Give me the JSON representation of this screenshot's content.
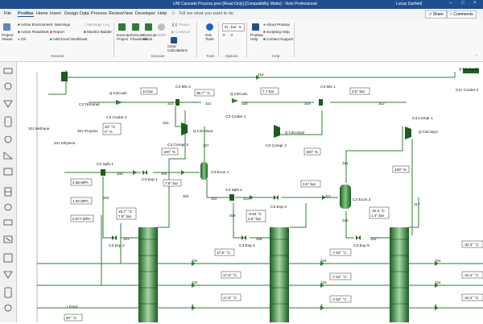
{
  "window": {
    "title": "UNI Cascade Process.pmx [Read Only] [Compatibility Mode] - Visio Professional",
    "user": "Lucas Garfield"
  },
  "menu": {
    "tabs": [
      "File",
      "ProMax",
      "Home",
      "Insert",
      "Design",
      "Data",
      "Process",
      "Review",
      "View",
      "Developer",
      "Help"
    ],
    "tell_me": "Tell me what you want to do",
    "share": "Share",
    "comments": "Comments"
  },
  "ribbon": {
    "project_viewer": "Project Viewer",
    "active_environment": "Active Environment",
    "active_flowsheet": "Active Flowsheet",
    "oil": "Oil",
    "warnings": "Warnings",
    "report": "Report",
    "add_excel_workbook": "Add Excel Workbook",
    "message_log": "Message Log",
    "monitor_builder": "Monitor Builder",
    "group_general": "General",
    "execute_project": "Execute Project",
    "execute_flowsheet": "Execute Flowsheet",
    "execute_block": "Execute Block",
    "abort": "Abort",
    "pause": "Pause",
    "continue": "Continue",
    "clear_calculations": "Clear Calculations",
    "group_execute": "Execute",
    "gis_tools": "GIS Tools",
    "group_tools": "Tools",
    "unit_select": "M - bar",
    "group_options": "Options",
    "promax_help": "ProMax Help",
    "about_promax": "About ProMax",
    "scripting_help": "Scripting Help",
    "contact_support": "Contact Support",
    "group_help": "Help"
  },
  "diagram": {
    "streams": {
      "s318": "318",
      "s320": "320",
      "s321": "321",
      "s319": "319",
      "s313": "313",
      "s322": "322",
      "s323": "323",
      "s307": "307",
      "s314": "314",
      "s317": "317",
      "s305": "305",
      "s306": "306",
      "s304": "304",
      "s302": "302",
      "s310": "310",
      "s312": "312",
      "s309": "309",
      "s311": "311",
      "s315": "315",
      "s303": "303",
      "s308": "308",
      "s316": "316",
      "s202": "202",
      "s203": "203",
      "s204": "204",
      "s102": "102",
      "s103": "103",
      "s104": "104",
      "s2": "2",
      "s3": "3",
      "s4": "4",
      "methane": "101 Methane",
      "ethylene": "201 Ethylene",
      "propane": "301 Propane",
      "feed": "1 Feed"
    },
    "blocks": {
      "c3_terminal": "C3 Terminal",
      "c3_cooler2": "C3 Cooler 2",
      "c3_mix2": "C3 Mix 2",
      "c3_cooler1": "C3 Cooler 1",
      "c3_mix1": "C3 Mix 1",
      "c3_compr3": "C3 Compr 3",
      "c3_compr2": "C3 Compr 2",
      "c3_compr1": "C3 Compr 1",
      "c3_split1": "C3 Split 1",
      "c3_exp1": "C3 Exp 1",
      "c3_econ1": "C3 Econ 1",
      "c3_split2": "C3 Split 2",
      "c3_exp3": "C3 Exp 3",
      "c3_econ2": "C3 Econ 2",
      "c3_exp2": "C3 Exp 2",
      "c3_exp4": "C3 Exp 4",
      "c3_exp5": "C3 Exp 5",
      "c2_cooler2": "C2+ Cooler 2"
    },
    "energy": {
      "q_c3cool2": "Q-C3Cool2",
      "q_c3cool1": "Q-C3Cool1",
      "q_c3comp3": "Q-C3Comp3",
      "q_c3comp2": "Q-C3Comp2",
      "q_c3comp1": "Q-C3Comp1",
      "q_c2cool2": "Q-C2+Cool2"
    },
    "readouts": {
      "t40_0": "40° °C",
      "pct0": "0° %",
      "bar14": "14 bar",
      "c357": "35.7° °C",
      "bar77": "7.7 bar",
      "bar35_top": "3.5° bar",
      "pct100_a": "100° %",
      "pct100_b": "100° %",
      "pct100_c": "100° %",
      "mpa458": "4.58 MPA",
      "mpa182": "1.82 MPA",
      "mpa0577": "0.577 MPA",
      "bar78": "7.8° bar",
      "bar35_mid": "3.5° bar",
      "c157": "15.7° °C",
      "bar78b": "7.8° bar",
      "c963": "-9.63 °C",
      "bar35b": "3.5° bar",
      "c344": "-34.4 °C",
      "bar14b": "1.4° bar",
      "c178a": "17.8° °C",
      "c178b": "17.8° °C",
      "c178c": "17.8° °C",
      "cm763a": "-7.63° °C",
      "cm763b": "-7.63° °C",
      "cm763c": "-7.63° °C",
      "cm324a": "-32.4° °C",
      "cm324b": "-32.4° °C",
      "cm324c": "-32.4° °C",
      "feed_t": "40° °C"
    }
  }
}
